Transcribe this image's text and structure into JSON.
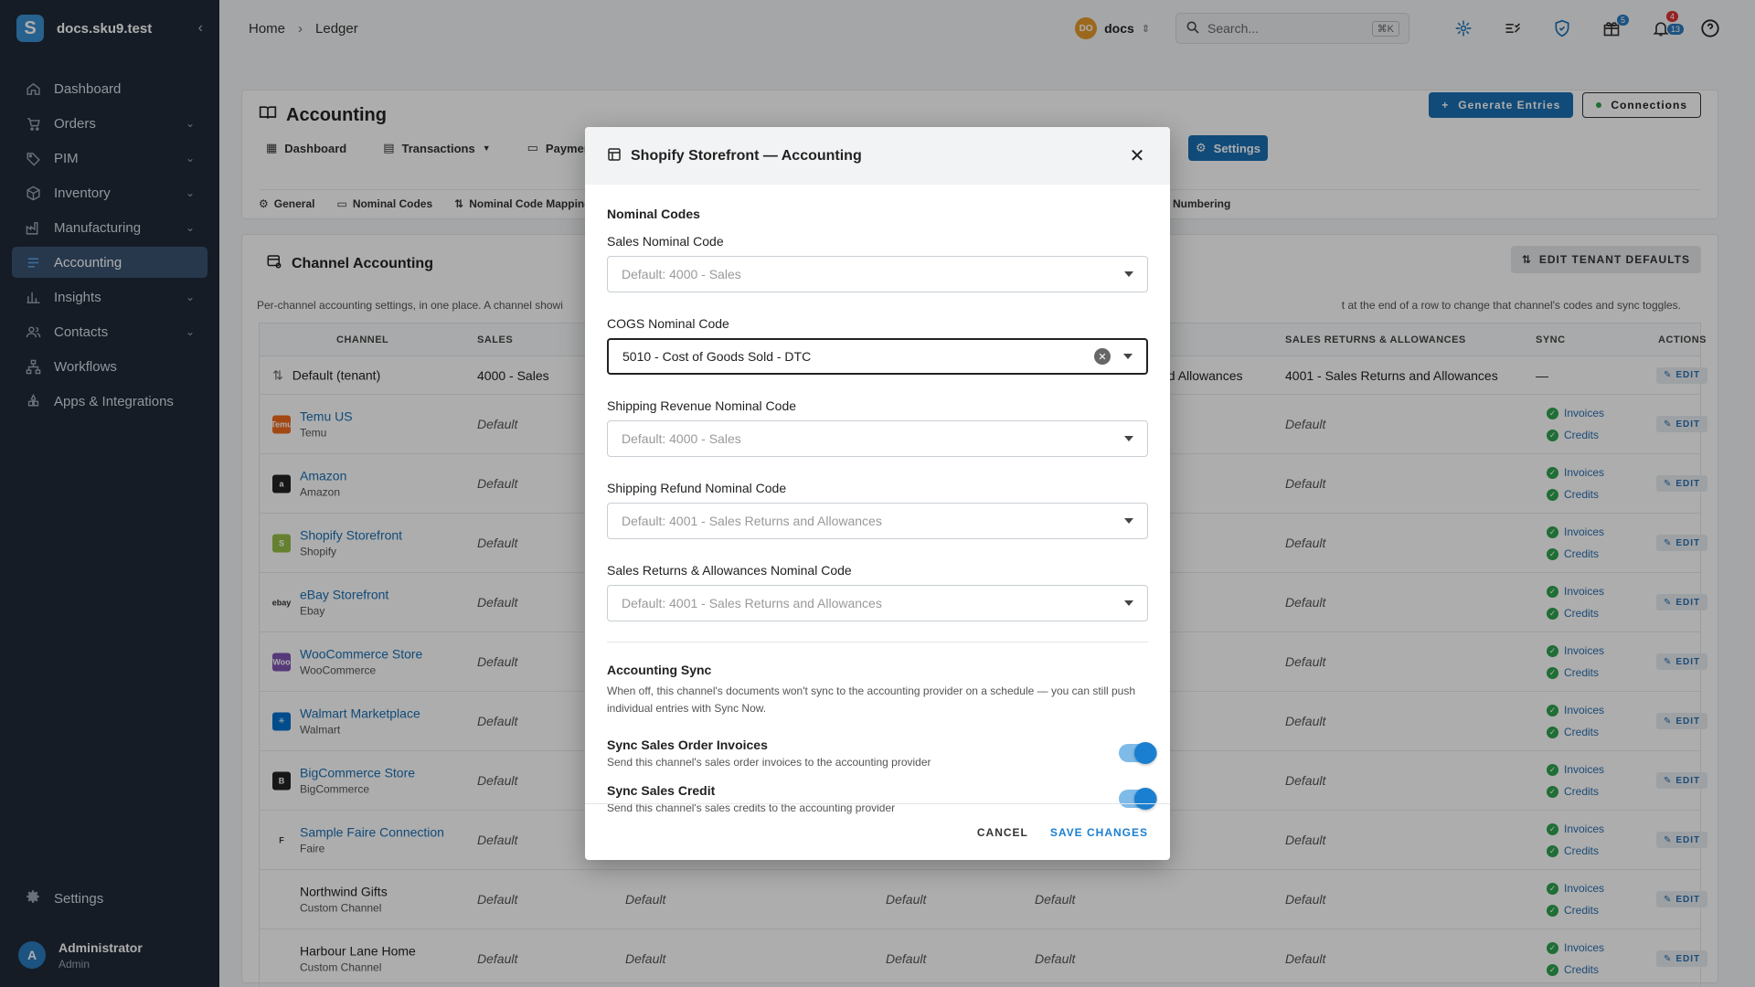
{
  "sidebar": {
    "logo": "S",
    "domain": "docs.sku9.test",
    "items": [
      {
        "label": "Dashboard",
        "icon": "home-icon",
        "chevron": false
      },
      {
        "label": "Orders",
        "icon": "cart-icon",
        "chevron": true
      },
      {
        "label": "PIM",
        "icon": "tag-icon",
        "chevron": true
      },
      {
        "label": "Inventory",
        "icon": "box-icon",
        "chevron": true
      },
      {
        "label": "Manufacturing",
        "icon": "factory-icon",
        "chevron": true
      },
      {
        "label": "Accounting",
        "icon": "accounting-icon",
        "chevron": false,
        "active": true
      },
      {
        "label": "Insights",
        "icon": "chart-icon",
        "chevron": true
      },
      {
        "label": "Contacts",
        "icon": "contacts-icon",
        "chevron": true
      },
      {
        "label": "Workflows",
        "icon": "workflow-icon",
        "chevron": false
      },
      {
        "label": "Apps & Integrations",
        "icon": "apps-icon",
        "chevron": false
      }
    ],
    "settings": "Settings",
    "user": {
      "initial": "A",
      "name": "Administrator",
      "role": "Admin"
    }
  },
  "topbar": {
    "crumbs": [
      "Home",
      "Ledger"
    ],
    "tenant_initials": "DO",
    "tenant_name": "docs",
    "search_placeholder": "Search...",
    "search_kbd": "⌘K",
    "gift_badge": "5",
    "bell_badge_red": "4",
    "bell_badge_blue": "13"
  },
  "accounting": {
    "title": "Accounting",
    "generate": "Generate Entries",
    "connections": "Connections",
    "tabs": [
      "Dashboard",
      "Transactions",
      "Payments"
    ],
    "active_tab": "Settings",
    "subtabs": [
      "General",
      "Nominal Codes",
      "Nominal Code Mapping"
    ],
    "subtab_numbering": "Numbering"
  },
  "channel": {
    "title": "Channel Accounting",
    "edit_defaults": "EDIT TENANT DEFAULTS",
    "desc_left": "Per-channel accounting settings, in one place. A channel showi",
    "desc_right": "t at the end of a row to change that channel's codes and sync toggles.",
    "headers": {
      "channel": "CHANNEL",
      "sales": "SALES",
      "returns": "SALES RETURNS & ALLOWANCES",
      "sync": "SYNC",
      "actions": "ACTIONS"
    },
    "tenant_row": {
      "name": "Default (tenant)",
      "sales": "4000 - Sales",
      "partial": "nd Allowances",
      "returns": "4001 - Sales Returns and Allowances",
      "sync": "—",
      "edit": "EDIT"
    },
    "rows": [
      {
        "name": "Temu US",
        "sub": "Temu",
        "link": true,
        "icon_color": "#f26b1d",
        "icon_text": "Temu"
      },
      {
        "name": "Amazon",
        "sub": "Amazon",
        "link": true,
        "icon_color": "#222222",
        "icon_text": "a"
      },
      {
        "name": "Shopify Storefront",
        "sub": "Shopify",
        "link": true,
        "icon_color": "#95bf47",
        "icon_text": "S"
      },
      {
        "name": "eBay Storefront",
        "sub": "Ebay",
        "link": true,
        "icon_color": "#ffffff",
        "icon_text": "ebay"
      },
      {
        "name": "WooCommerce Store",
        "sub": "WooCommerce",
        "link": true,
        "icon_color": "#7f54b3",
        "icon_text": "Woo"
      },
      {
        "name": "Walmart Marketplace",
        "sub": "Walmart",
        "link": true,
        "icon_color": "#0071ce",
        "icon_text": "✳"
      },
      {
        "name": "BigCommerce Store",
        "sub": "BigCommerce",
        "link": true,
        "icon_color": "#222222",
        "icon_text": "B"
      },
      {
        "name": "Sample Faire Connection",
        "sub": "Faire",
        "link": true,
        "icon_color": "#ffffff",
        "icon_text": "F"
      },
      {
        "name": "Northwind Gifts",
        "sub": "Custom Channel",
        "link": false,
        "icon_color": "",
        "icon_text": ""
      },
      {
        "name": "Harbour Lane Home",
        "sub": "Custom Channel",
        "link": false,
        "icon_color": "",
        "icon_text": ""
      }
    ],
    "default_label": "Default",
    "invoices": "Invoices",
    "credits": "Credits",
    "edit": "EDIT"
  },
  "modal": {
    "title": "Shopify Storefront — Accounting",
    "section_codes": "Nominal Codes",
    "fields": [
      {
        "label": "Sales Nominal Code",
        "value": "Default: 4000 - Sales",
        "filled": false
      },
      {
        "label": "COGS Nominal Code",
        "value": "5010 - Cost of Goods Sold - DTC",
        "filled": true
      },
      {
        "label": "Shipping Revenue Nominal Code",
        "value": "Default: 4000 - Sales",
        "filled": false
      },
      {
        "label": "Shipping Refund Nominal Code",
        "value": "Default: 4001 - Sales Returns and Allowances",
        "filled": false
      },
      {
        "label": "Sales Returns & Allowances Nominal Code",
        "value": "Default: 4001 - Sales Returns and Allowances",
        "filled": false
      }
    ],
    "section_sync": "Accounting Sync",
    "sync_desc": "When off, this channel's documents won't sync to the accounting provider on a schedule — you can still push individual entries with Sync Now.",
    "toggles": [
      {
        "title": "Sync Sales Order Invoices",
        "desc": "Send this channel's sales order invoices to the accounting provider",
        "on": true
      },
      {
        "title": "Sync Sales Credit",
        "desc": "Send this channel's sales credits to the accounting provider",
        "on": true
      }
    ],
    "cancel": "CANCEL",
    "save": "SAVE CHANGES"
  }
}
